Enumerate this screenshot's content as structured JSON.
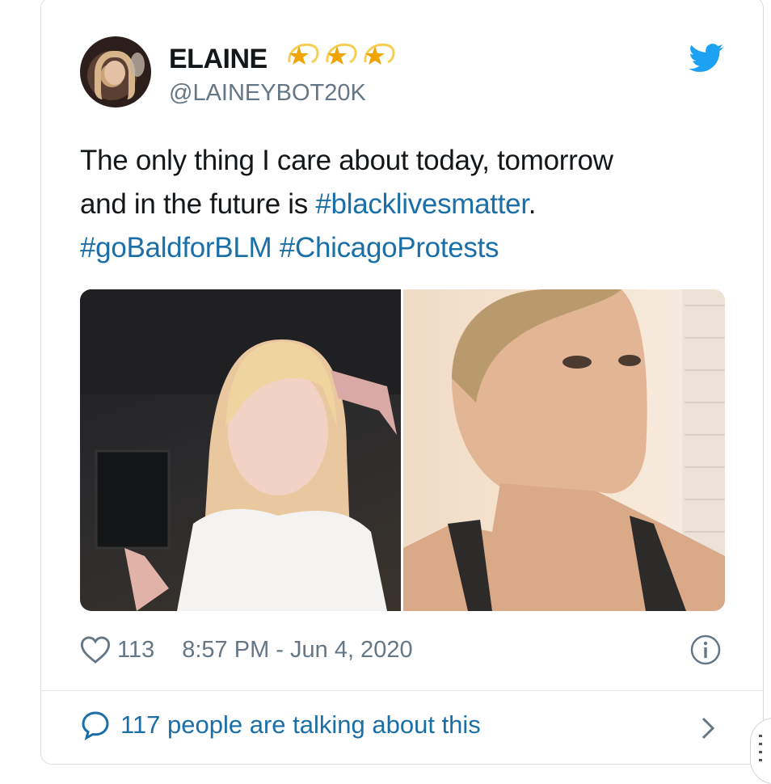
{
  "tweet": {
    "display_name": "ELAINE",
    "handle": "@LAINEYBOT20K",
    "name_emoji": [
      "dizzy-star-emoji",
      "dizzy-star-emoji",
      "dizzy-star-emoji"
    ],
    "text_line1": "The only thing I care about today, tomorrow",
    "text_line2_prefix": "and in the future is ",
    "hashtag_1": "#blacklivesmatter",
    "text_line2_suffix": ".",
    "hashtag_2": "#goBaldforBLM",
    "hashtag_3": "#ChicagoProtests",
    "media": [
      {
        "icon": "photo-before-long-blonde-hair"
      },
      {
        "icon": "photo-after-shaved-head"
      }
    ],
    "like_count": "113",
    "timestamp": "8:57 PM - Jun 4, 2020",
    "talking_text": "117 people are talking about this"
  },
  "colors": {
    "text": "#14171a",
    "secondary": "#657786",
    "link": "#1b6fa8",
    "twitter_blue": "#1da1f2",
    "star_gold": "#f0a400"
  }
}
